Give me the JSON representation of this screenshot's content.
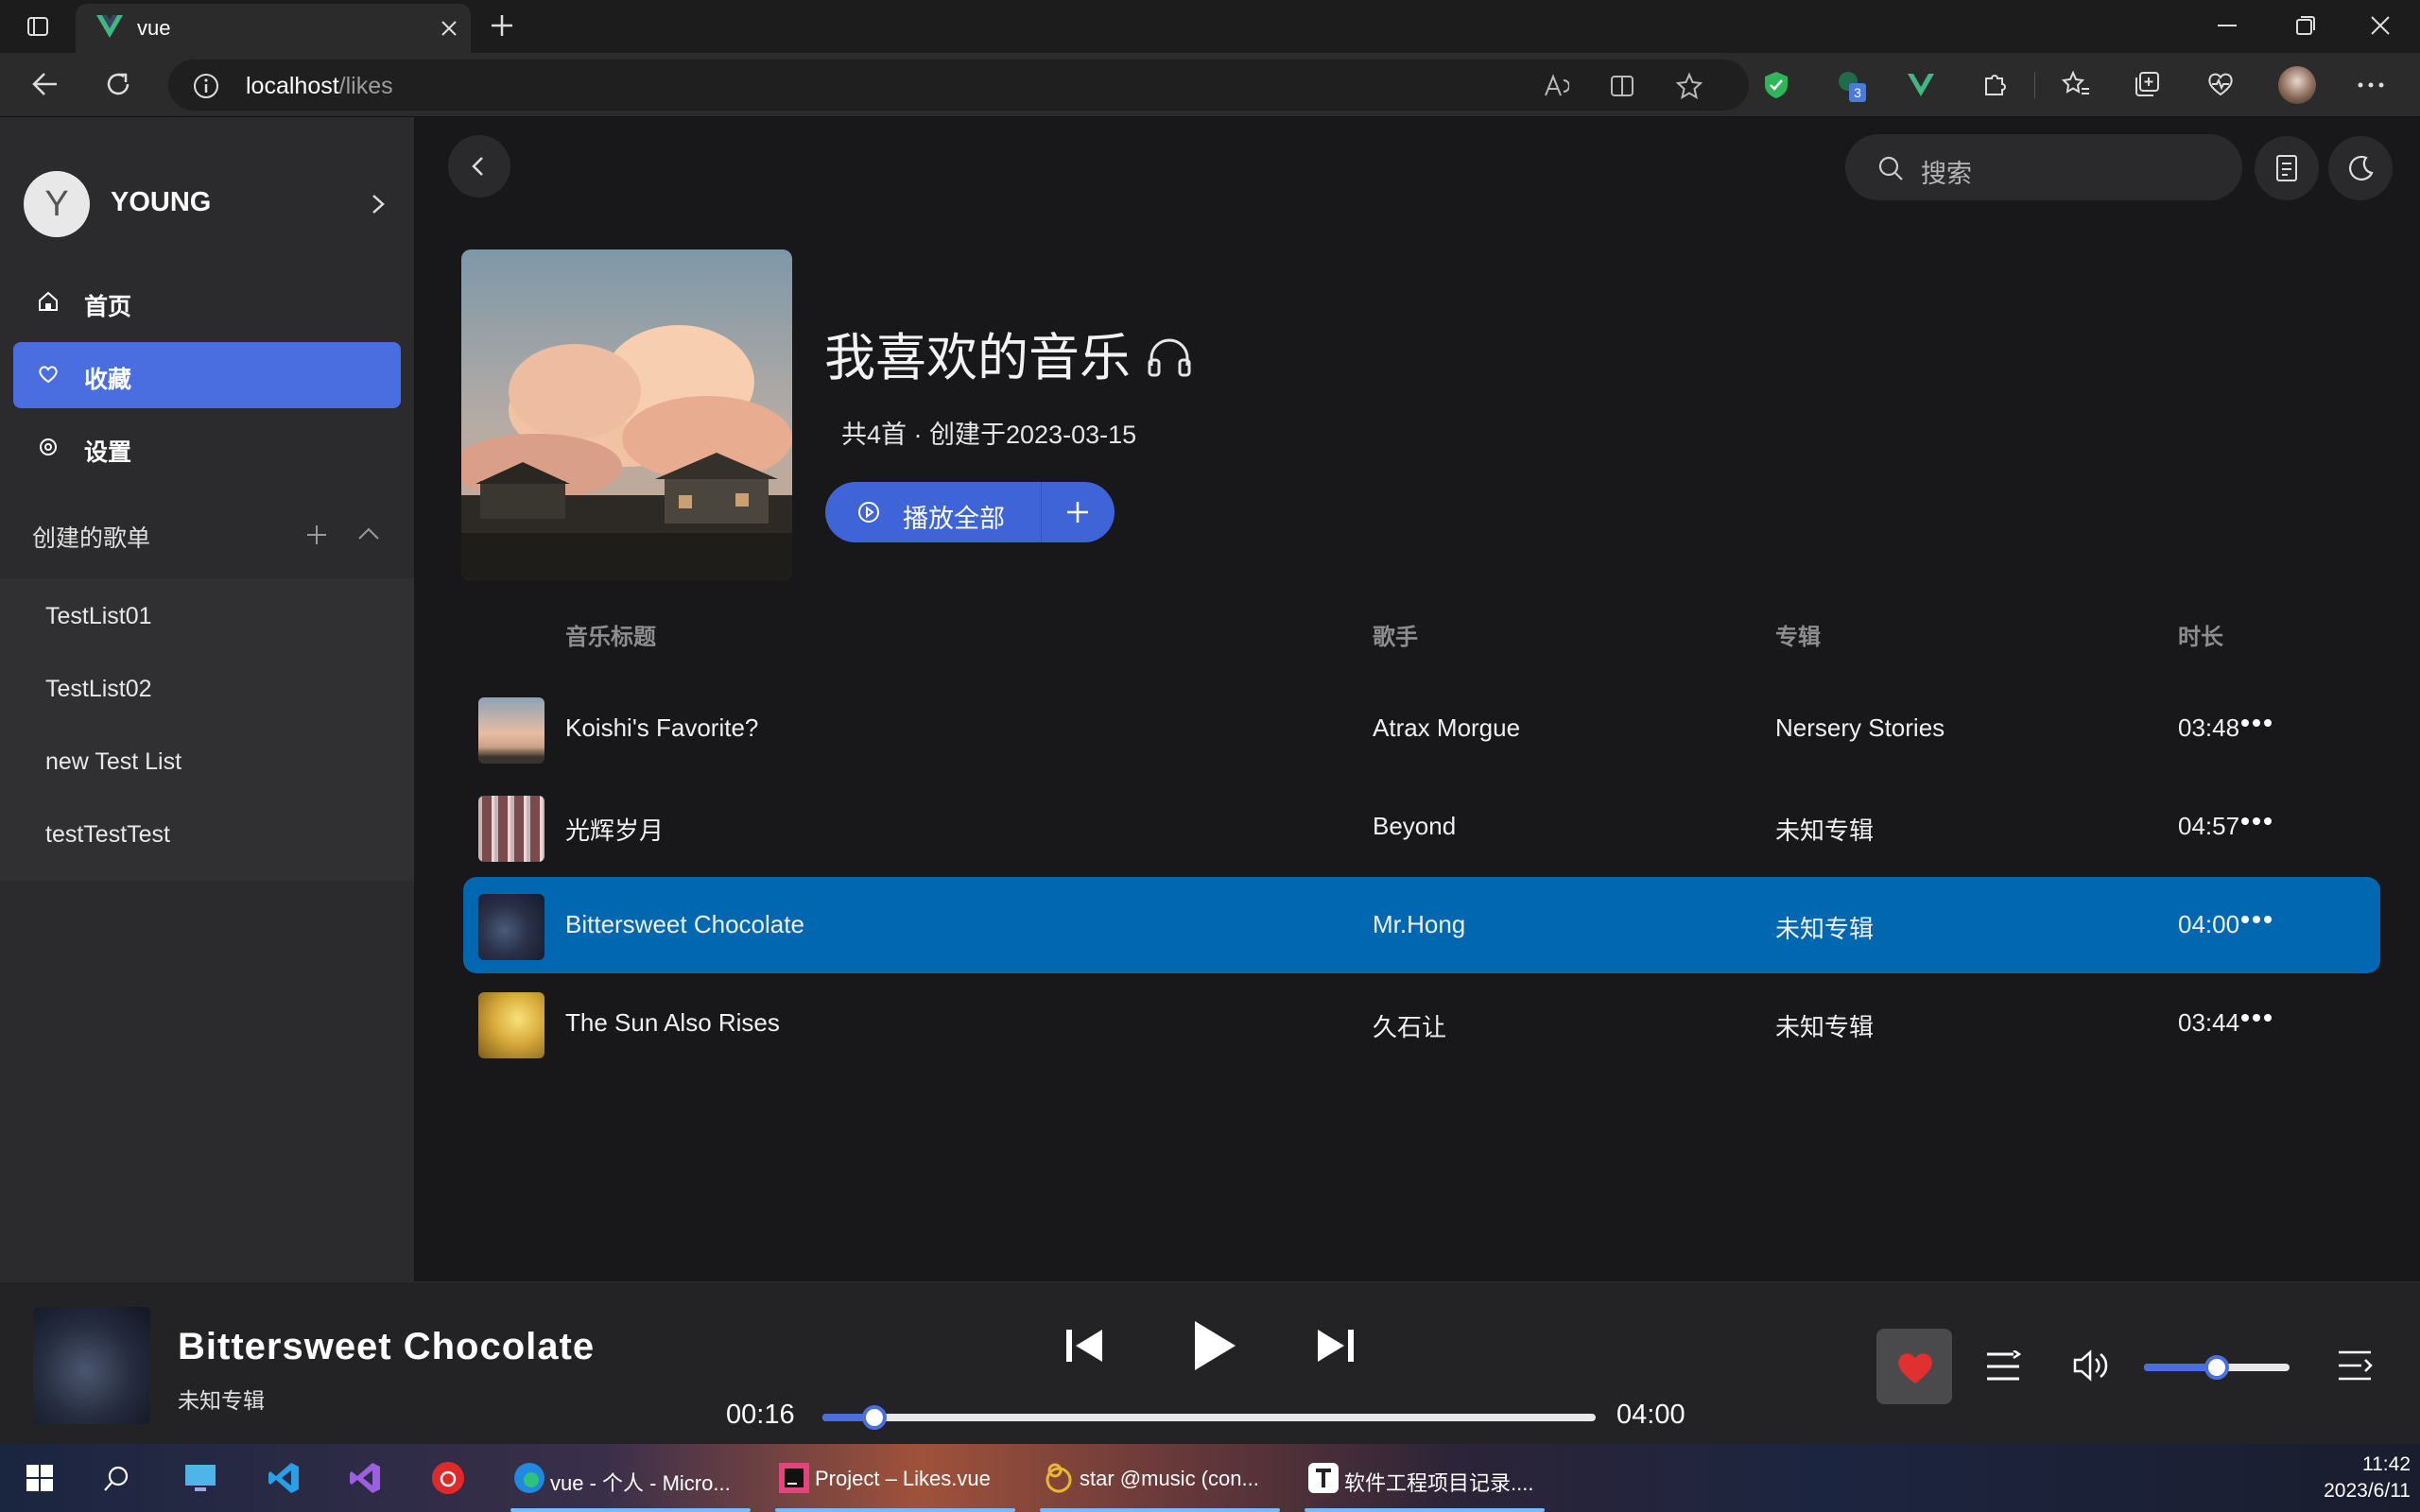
{
  "browser": {
    "tab_title": "vue",
    "url_host": "localhost",
    "url_path": "/likes",
    "extension_badge": "3"
  },
  "sidebar": {
    "avatar_letter": "Y",
    "user_name": "YOUNG",
    "nav": [
      {
        "label": "首页",
        "icon": "home-icon"
      },
      {
        "label": "收藏",
        "icon": "heart-icon",
        "active": true
      },
      {
        "label": "设置",
        "icon": "settings-icon"
      }
    ],
    "playlist_header": "创建的歌单",
    "playlists": [
      "TestList01",
      "TestList02",
      "new Test List",
      "testTestTest"
    ]
  },
  "main": {
    "search_placeholder": "搜索",
    "playlist_title": "我喜欢的音乐",
    "playlist_meta": "共4首 · 创建于2023-03-15",
    "play_all_label": "播放全部",
    "columns": {
      "title": "音乐标题",
      "artist": "歌手",
      "album": "专辑",
      "duration": "时长"
    },
    "songs": [
      {
        "title": "Koishi's Favorite?",
        "artist": "Atrax Morgue",
        "album": "Nersery Stories",
        "duration": "03:48"
      },
      {
        "title": "光辉岁月",
        "artist": "Beyond",
        "album": "未知专辑",
        "duration": "04:57"
      },
      {
        "title": "Bittersweet Chocolate",
        "artist": "Mr.Hong",
        "album": "未知专辑",
        "duration": "04:00",
        "active": true
      },
      {
        "title": "The Sun Also Rises",
        "artist": "久石让",
        "album": "未知专辑",
        "duration": "03:44"
      }
    ]
  },
  "player": {
    "title": "Bittersweet Chocolate",
    "album": "未知专辑",
    "current_time": "00:16",
    "total_time": "04:00",
    "progress_fraction": 0.067,
    "volume_fraction": 0.5,
    "accent_color": "#4a6ee0",
    "liked_color": "#e03030"
  },
  "taskbar": {
    "apps": [
      {
        "label": "vue - 个人 - Micro..."
      },
      {
        "label": "Project – Likes.vue"
      },
      {
        "label": "star @music (con..."
      },
      {
        "label": "软件工程项目记录...."
      }
    ],
    "time": "11:42",
    "date": "2023/6/11"
  }
}
